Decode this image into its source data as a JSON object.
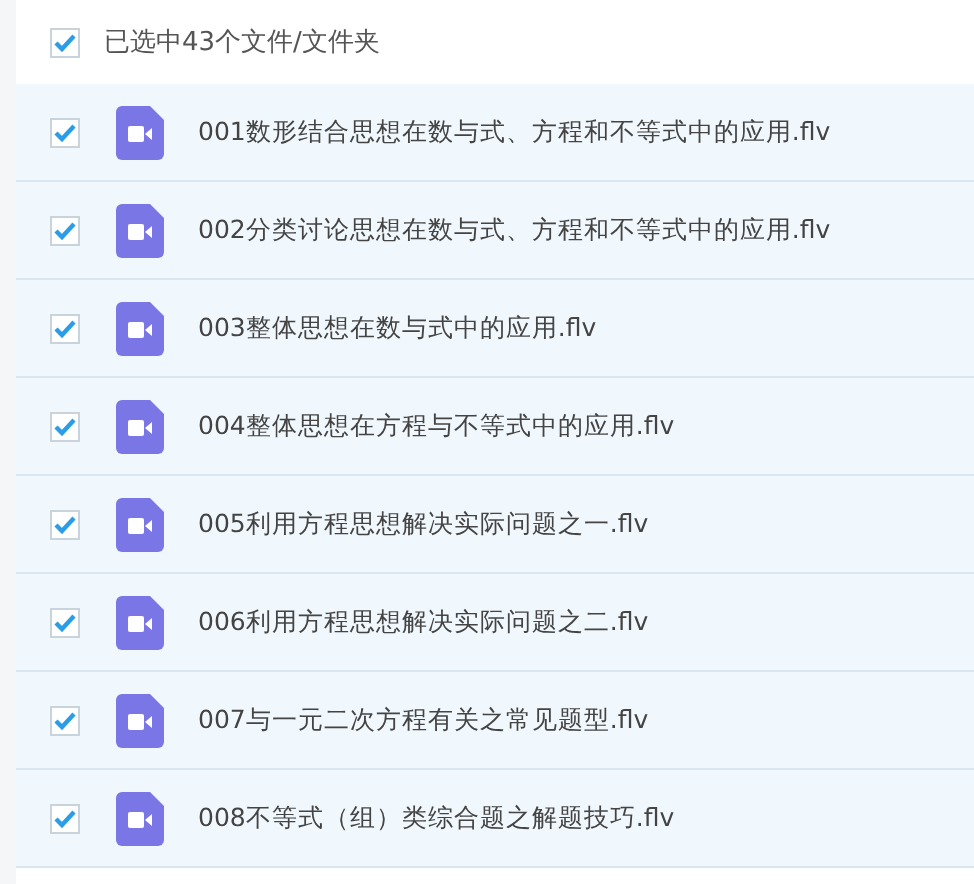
{
  "header": {
    "checked": true,
    "label": "已选中43个文件/文件夹"
  },
  "files": [
    {
      "name": "001数形结合思想在数与式、方程和不等式中的应用.flv",
      "checked": true
    },
    {
      "name": "002分类讨论思想在数与式、方程和不等式中的应用.flv",
      "checked": true
    },
    {
      "name": "003整体思想在数与式中的应用.flv",
      "checked": true
    },
    {
      "name": "004整体思想在方程与不等式中的应用.flv",
      "checked": true
    },
    {
      "name": "005利用方程思想解决实际问题之一.flv",
      "checked": true
    },
    {
      "name": "006利用方程思想解决实际问题之二.flv",
      "checked": true
    },
    {
      "name": "007与一元二次方程有关之常见题型.flv",
      "checked": true
    },
    {
      "name": "008不等式（组）类综合题之解题技巧.flv",
      "checked": true
    }
  ]
}
